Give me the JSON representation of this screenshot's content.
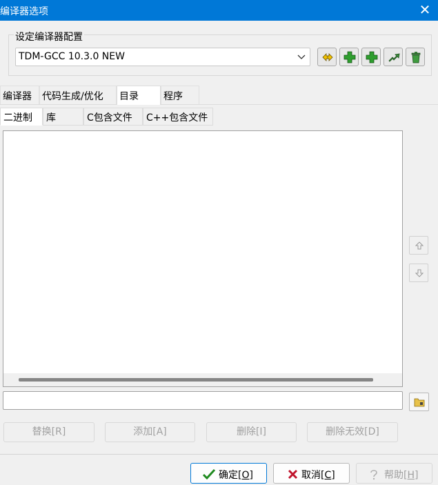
{
  "window": {
    "title": "编译器选项"
  },
  "config": {
    "group_label": "设定编译器配置",
    "selected": "TDM-GCC 10.3.0 NEW",
    "toolbar_icons": [
      "rename-icon",
      "add-icon",
      "add-copy-icon",
      "export-icon",
      "delete-icon"
    ]
  },
  "tabs": [
    {
      "label": "编译器"
    },
    {
      "label": "代码生成/优化"
    },
    {
      "label": "目录",
      "active": true
    },
    {
      "label": "程序"
    }
  ],
  "subtabs": [
    {
      "label": "二进制",
      "active": true
    },
    {
      "label": "库"
    },
    {
      "label": "C包含文件"
    },
    {
      "label": "C++包含文件"
    }
  ],
  "directory_list": [],
  "path_input": {
    "value": "",
    "placeholder": ""
  },
  "actions": {
    "replace": "替换[R]",
    "add": "添加[A]",
    "delete": "删除[I]",
    "delete_invalid": "删除无效[D]"
  },
  "dialog_buttons": {
    "ok_label": "确定[",
    "ok_key": "O",
    "cancel_label": "取消[",
    "cancel_key": "C",
    "help_label": "帮助[",
    "help_key": "H",
    "close_bracket": "]"
  },
  "colors": {
    "titlebar": "#0078d7",
    "accent": "#0078d7",
    "add_green": "#2e9e2e",
    "cancel_red": "#c0142c"
  }
}
